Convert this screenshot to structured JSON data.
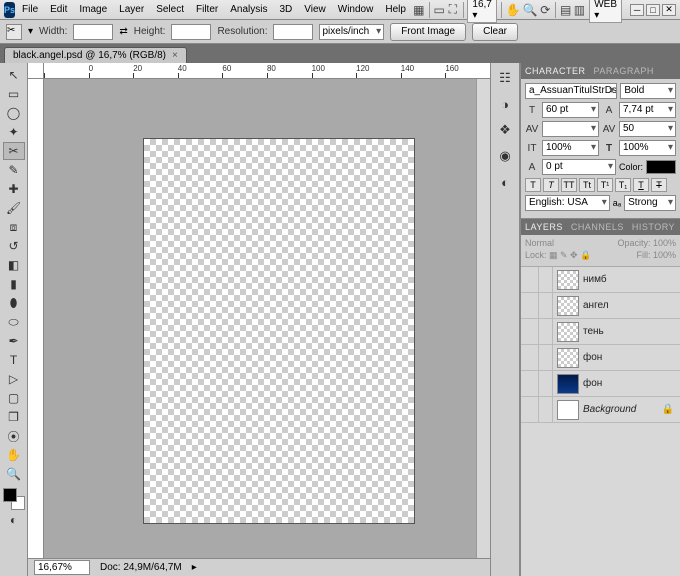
{
  "menu": [
    "File",
    "Edit",
    "Image",
    "Layer",
    "Select",
    "Filter",
    "Analysis",
    "3D",
    "View",
    "Window",
    "Help"
  ],
  "top_zoom": "16,7",
  "workspace": "WEB",
  "options": {
    "width_label": "Width:",
    "height_label": "Height:",
    "res_label": "Resolution:",
    "res_unit": "pixels/inch",
    "front_btn": "Front Image",
    "clear_btn": "Clear"
  },
  "tab": {
    "title": "black.angel.psd @ 16,7% (RGB/8)"
  },
  "ruler_ticks": [
    "0",
    "20",
    "40",
    "60",
    "80",
    "100",
    "120",
    "140",
    "160"
  ],
  "status": {
    "zoom": "16,67%",
    "doc": "Doc: 24,9M/64,7M"
  },
  "char_panel": {
    "tab1": "CHARACTER",
    "tab2": "PARAGRAPH",
    "font": "a_AssuanTitulStrDst",
    "style": "Bold",
    "size": "60 pt",
    "leading": "7,74 pt",
    "tracking": "50",
    "vscale": "100%",
    "hscale": "100%",
    "baseline": "0 pt",
    "color_label": "Color:",
    "lang": "English: USA",
    "aa": "Strong"
  },
  "layers_panel": {
    "tab1": "LAYERS",
    "tab2": "CHANNELS",
    "tab3": "HISTORY",
    "blend": "Normal",
    "opacity_label": "Opacity:",
    "opacity": "100%",
    "lock_label": "Lock:",
    "fill_label": "Fill:",
    "fill": "100%",
    "layers": [
      {
        "name": "нимб",
        "thumb": "check"
      },
      {
        "name": "ангел",
        "thumb": "check"
      },
      {
        "name": "тень",
        "thumb": "check"
      },
      {
        "name": "фон",
        "thumb": "check"
      },
      {
        "name": "фон",
        "thumb": "blue"
      },
      {
        "name": "Background",
        "thumb": "white",
        "italic": true,
        "locked": true
      }
    ]
  }
}
